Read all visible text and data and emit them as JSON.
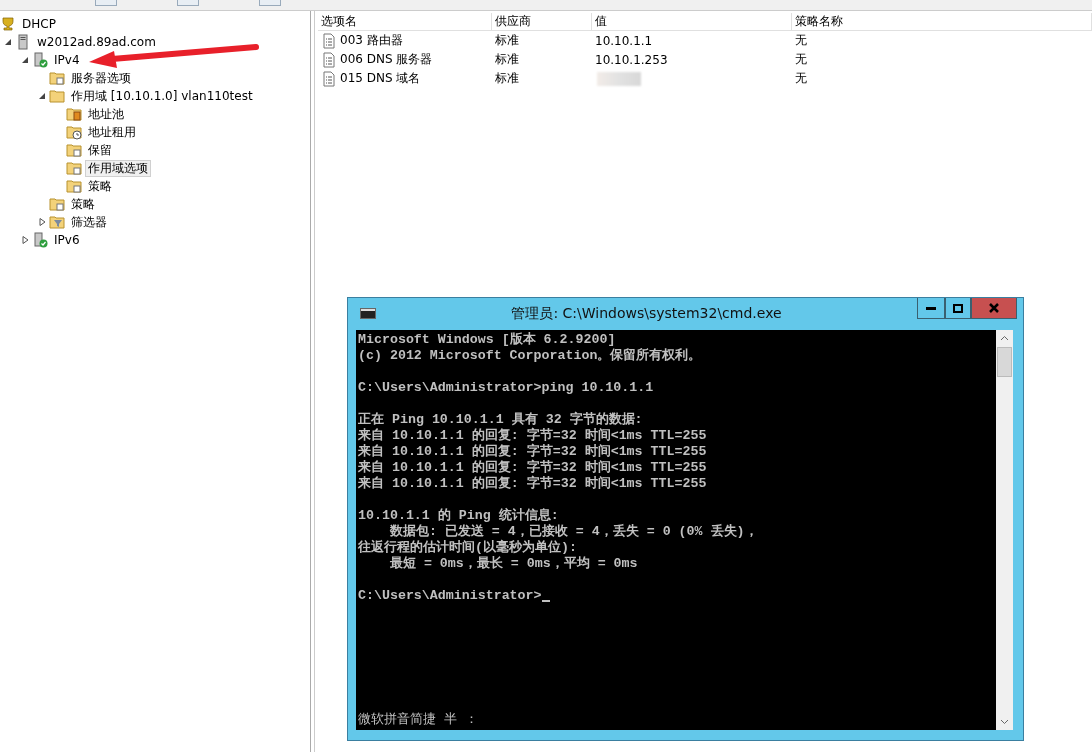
{
  "tree": [
    {
      "label": "DHCP",
      "kind": "dhcp",
      "selected": false,
      "children": [
        {
          "label": "w2012ad.89ad.com",
          "kind": "server",
          "expanded": true,
          "selected": false,
          "children": [
            {
              "label": "IPv4",
              "kind": "ipv",
              "expanded": true,
              "selected": false,
              "children": [
                {
                  "label": "服务器选项",
                  "kind": "options",
                  "selected": false
                },
                {
                  "label": "作用域 [10.10.1.0] vlan110test",
                  "kind": "folder",
                  "expanded": true,
                  "selected": false,
                  "children": [
                    {
                      "label": "地址池",
                      "kind": "pool",
                      "selected": false
                    },
                    {
                      "label": "地址租用",
                      "kind": "lease",
                      "selected": false
                    },
                    {
                      "label": "保留",
                      "kind": "reserve",
                      "selected": false
                    },
                    {
                      "label": "作用域选项",
                      "kind": "options",
                      "selected": true
                    },
                    {
                      "label": "策略",
                      "kind": "policy",
                      "selected": false
                    }
                  ]
                },
                {
                  "label": "策略",
                  "kind": "policy",
                  "selected": false
                },
                {
                  "label": "筛选器",
                  "kind": "filter",
                  "expanded": false,
                  "selected": false
                }
              ]
            },
            {
              "label": "IPv6",
              "kind": "ipv",
              "expanded": false,
              "selected": false
            }
          ]
        }
      ]
    }
  ],
  "table": {
    "columns": [
      "选项名",
      "供应商",
      "值",
      "策略名称"
    ],
    "rows": [
      {
        "name": "003 路由器",
        "vendor": "标准",
        "value": "10.10.1.1",
        "policy": "无",
        "redacted": false
      },
      {
        "name": "006 DNS 服务器",
        "vendor": "标准",
        "value": "10.10.1.253",
        "policy": "无",
        "redacted": false
      },
      {
        "name": "015 DNS 域名",
        "vendor": "标准",
        "redacted": true,
        "policy": "无"
      }
    ]
  },
  "console": {
    "title": "管理员: C:\\Windows\\system32\\cmd.exe",
    "blocks": [
      [
        "Microsoft Windows [版本 6.2.9200]",
        "(c) 2012 Microsoft Corporation。保留所有权利。"
      ],
      [
        "C:\\Users\\Administrator>ping 10.10.1.1"
      ],
      [
        "正在 Ping 10.10.1.1 具有 32 字节的数据:",
        "来自 10.10.1.1 的回复: 字节=32 时间<1ms TTL=255",
        "来自 10.10.1.1 的回复: 字节=32 时间<1ms TTL=255",
        "来自 10.10.1.1 的回复: 字节=32 时间<1ms TTL=255",
        "来自 10.10.1.1 的回复: 字节=32 时间<1ms TTL=255"
      ],
      [
        "10.10.1.1 的 Ping 统计信息:",
        "    数据包: 已发送 = 4，已接收 = 4，丢失 = 0 (0% 丢失)，",
        "往返行程的估计时间(以毫秒为单位):",
        "    最短 = 0ms，最长 = 0ms，平均 = 0ms"
      ],
      [
        "C:\\Users\\Administrator>"
      ]
    ],
    "cursor": true,
    "ime_status": "微软拼音简捷 半 ："
  }
}
